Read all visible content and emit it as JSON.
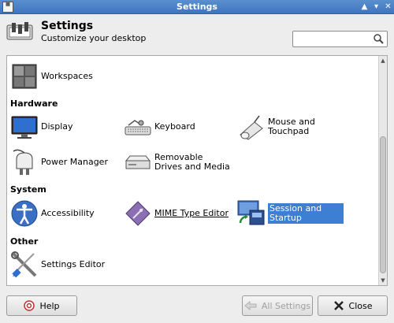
{
  "window": {
    "title": "Settings"
  },
  "header": {
    "title": "Settings",
    "subtitle": "Customize your desktop"
  },
  "search": {
    "value": "",
    "placeholder": ""
  },
  "sections": {
    "hardware": "Hardware",
    "system": "System",
    "other": "Other"
  },
  "items": {
    "workspaces": "Workspaces",
    "display": "Display",
    "keyboard": "Keyboard",
    "mouse": "Mouse and Touchpad",
    "power": "Power Manager",
    "removable": "Removable Drives and Media",
    "accessibility": "Accessibility",
    "mime": "MIME Type Editor",
    "session": "Session and Startup",
    "settings_editor": "Settings Editor"
  },
  "buttons": {
    "help": "Help",
    "all_settings": "All Settings",
    "close": "Close"
  }
}
